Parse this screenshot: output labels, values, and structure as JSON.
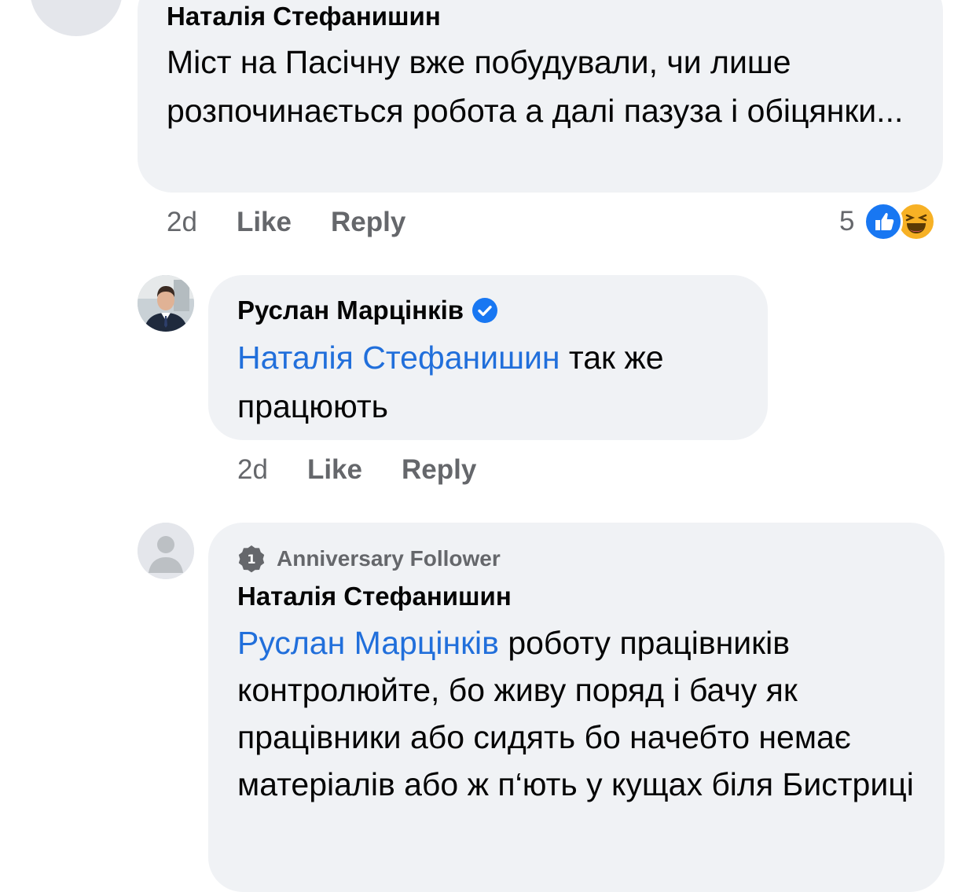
{
  "comments": [
    {
      "author": "Наталія Стефанишин",
      "text": "Міст на Пасічну вже побудували, чи лише розпочинається робота а далі пазуза і обіцянки...",
      "time": "2d",
      "like_label": "Like",
      "reply_label": "Reply",
      "reaction_count": "5",
      "reaction_icons": [
        "like-icon",
        "haha-icon"
      ]
    },
    {
      "author": "Руслан Марцінків",
      "verified": true,
      "mention": "Наталія Стефанишин",
      "text": " так же працюють",
      "time": "2d",
      "like_label": "Like",
      "reply_label": "Reply"
    },
    {
      "badge": "Anniversary Follower",
      "badge_number": "1",
      "author": "Наталія Стефанишин",
      "mention": "Руслан Марцінків",
      "text": " роботу працівників контролюйте, бо живу поряд і бачу як працівники або сидять бо начебто немає матеріалів або ж п‘ють у кущах біля Бистриці"
    }
  ],
  "colors": {
    "bubble": "#f0f2f5",
    "mention": "#216fdb",
    "secondary_text": "#65676b",
    "like_blue": "#1877f2",
    "haha_yellow": "#f7b125"
  }
}
